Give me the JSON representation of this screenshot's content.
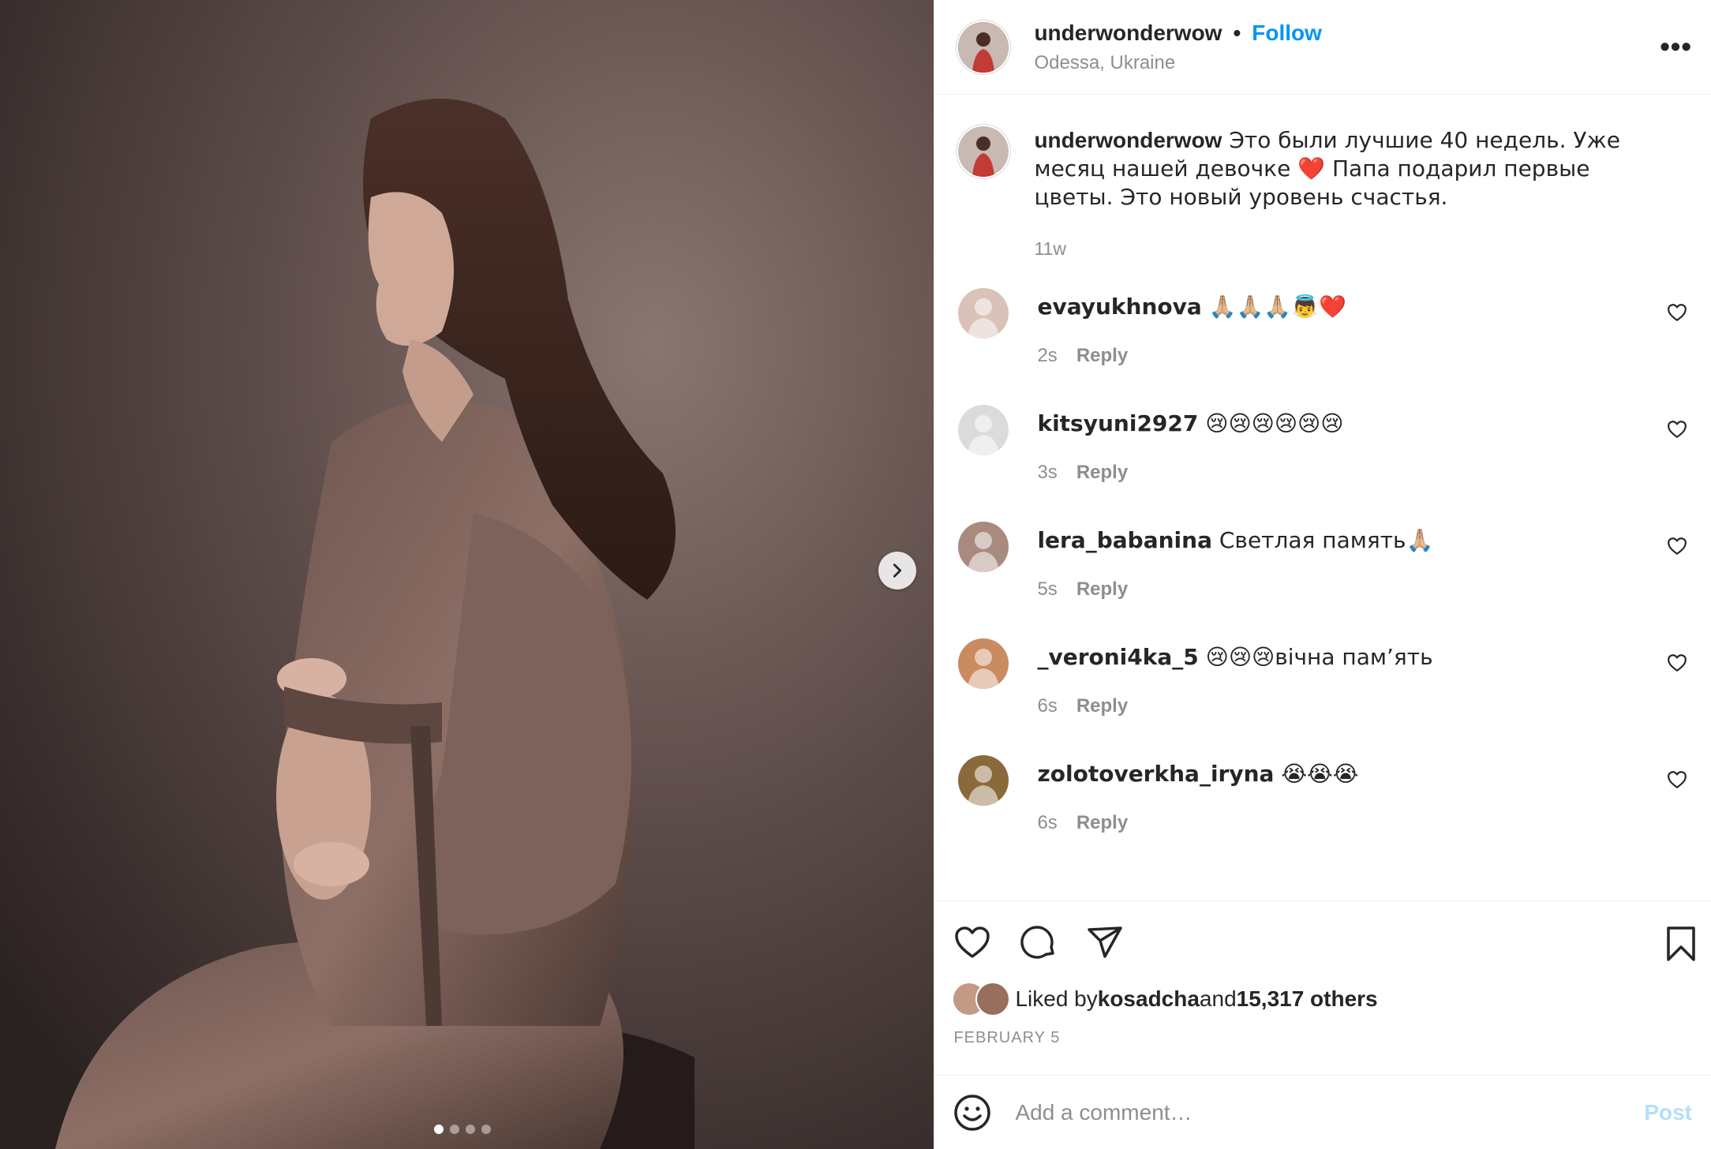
{
  "post": {
    "author": "underwonderwow",
    "separator": "•",
    "follow_label": "Follow",
    "location": "Odessa, Ukraine",
    "more_label": "•••",
    "caption": {
      "username": "underwonderwow",
      "text": " Это были лучшие 40 недель. Уже месяц нашей девочке ❤️ Папа подарил первые цветы. Это новый уровень счастья.",
      "age": "11w"
    }
  },
  "carousel": {
    "total": 4,
    "current": 1,
    "next_icon": "chevron-right-icon"
  },
  "comments": [
    {
      "username": "evayukhnova",
      "text": " 🙏🏼🙏🏼🙏🏼👼❤️",
      "age": "2s",
      "reply_label": "Reply",
      "avatar_color": "#d9c2b8"
    },
    {
      "username": "kitsyuni2927",
      "text": " 😢😢😢😢😢😢",
      "age": "3s",
      "reply_label": "Reply",
      "avatar_color": "#dbdbdb"
    },
    {
      "username": "lera_babanina",
      "text": " Светлая память🙏🏼",
      "age": "5s",
      "reply_label": "Reply",
      "avatar_color": "#a88a7e"
    },
    {
      "username": "_veroni4ka_5",
      "text": " 😢😢😢вічна пам’ять",
      "age": "6s",
      "reply_label": "Reply",
      "avatar_color": "#c98b5f"
    },
    {
      "username": "zolotoverkha_iryna",
      "text": " 😭😭😭",
      "age": "6s",
      "reply_label": "Reply",
      "avatar_color": "#8a6a3a"
    }
  ],
  "likes": {
    "prefix": "Liked by ",
    "user": "kosadcha",
    "conjunction": " and ",
    "others": "15,317 others"
  },
  "date": "FEBRUARY 5",
  "add_comment": {
    "placeholder": "Add a comment…",
    "post_label": "Post"
  },
  "colors": {
    "accent": "#0095f6",
    "muted": "#8e8e8e",
    "text": "#262626",
    "post_disabled": "#b2dffc"
  },
  "icons": [
    "heart-icon",
    "comment-icon",
    "share-icon",
    "bookmark-icon",
    "emoji-icon",
    "more-icon",
    "chevron-right-icon"
  ]
}
